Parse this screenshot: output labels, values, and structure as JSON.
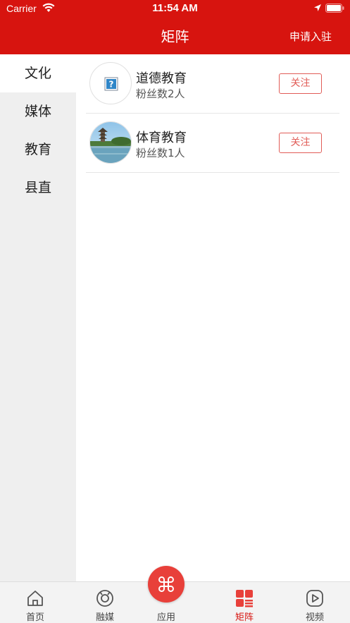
{
  "status_bar": {
    "carrier": "Carrier",
    "time": "11:54 AM"
  },
  "header": {
    "title": "矩阵",
    "apply_label": "申请入驻"
  },
  "sidebar": {
    "items": [
      {
        "label": "文化",
        "active": true
      },
      {
        "label": "媒体",
        "active": false
      },
      {
        "label": "教育",
        "active": false
      },
      {
        "label": "县直",
        "active": false
      }
    ]
  },
  "list": [
    {
      "name": "道德教育",
      "fans": "粉丝数2人",
      "follow_label": "关注",
      "avatar": "placeholder-image-icon"
    },
    {
      "name": "体育教育",
      "fans": "粉丝数1人",
      "follow_label": "关注",
      "avatar": "lake-pagoda-photo"
    }
  ],
  "tabbar": {
    "items": [
      {
        "label": "首页",
        "icon": "home-icon"
      },
      {
        "label": "融媒",
        "icon": "media-icon"
      },
      {
        "label": "应用",
        "icon": "apps-icon"
      },
      {
        "label": "矩阵",
        "icon": "matrix-icon",
        "active": true
      },
      {
        "label": "视频",
        "icon": "video-icon"
      }
    ]
  },
  "colors": {
    "brand": "#d7140f",
    "follow": "#e15c57",
    "fab": "#e8403a"
  }
}
